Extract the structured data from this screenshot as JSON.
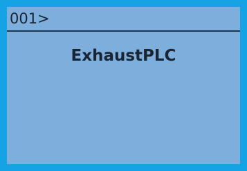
{
  "display": {
    "prompt": "001>",
    "device_name": "ExhaustPLC",
    "colors": {
      "border": "#16a3e6",
      "screen": "#7eaedc",
      "text": "#1a2533"
    }
  }
}
